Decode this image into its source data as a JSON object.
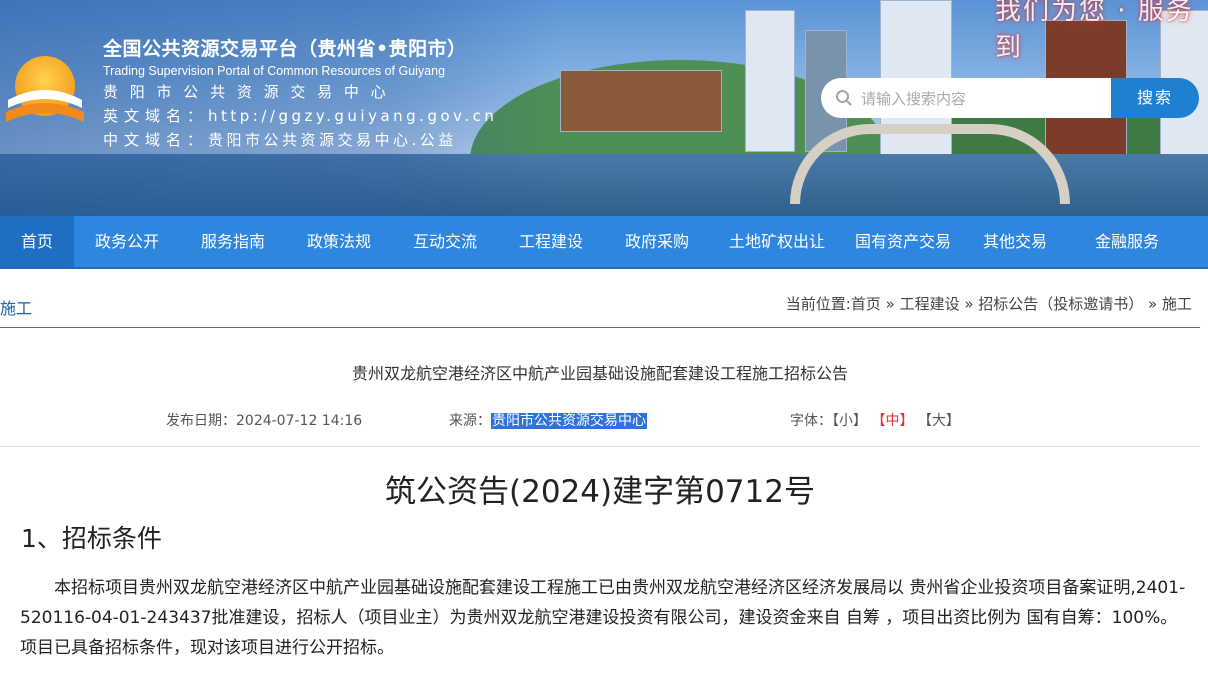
{
  "header": {
    "title_cn": "全国公共资源交易平台（贵州省•贵阳市）",
    "title_en": "Trading Supervision Portal of Common Resources of Guiyang",
    "center_name": "贵 阳 市 公 共 资 源 交 易 中 心",
    "en_domain_label": "英文域名：",
    "en_domain_value": "http://ggzy.guiyang.gov.cn",
    "cn_domain_label": "中文域名：",
    "cn_domain_value": "贵阳市公共资源交易中心.公益",
    "banner_slogan": "我们为您 · 服务到"
  },
  "search": {
    "placeholder": "请输入搜索内容",
    "button": "搜索"
  },
  "nav": {
    "items": [
      "首页",
      "政务公开",
      "服务指南",
      "政策法规",
      "互动交流",
      "工程建设",
      "政府采购",
      "土地矿权出让",
      "国有资产交易",
      "其他交易",
      "金融服务"
    ],
    "active": "首页"
  },
  "breadcrumb": {
    "category": "施工",
    "path": "当前位置:首页 » 工程建设 » 招标公告（投标邀请书） » 施工"
  },
  "article": {
    "title": "贵州双龙航空港经济区中航产业园基础设施配套建设工程施工招标公告",
    "date_label": "发布日期：",
    "date_value": "2024-07-12 14:16",
    "source_label": "来源：",
    "source_value": "贵阳市公共资源交易中心",
    "font_label": "字体：",
    "font_small": "【小】",
    "font_medium": "【中】",
    "font_large": "【大】",
    "doc_number": "筑公资告(2024)建字第0712号",
    "section_title": "1、招标条件",
    "paragraph": "本招标项目贵州双龙航空港经济区中航产业园基础设施配套建设工程施工已由贵州双龙航空港经济区经济发展局以 贵州省企业投资项目备案证明,2401-520116-04-01-243437批准建设，招标人（项目业主）为贵州双龙航空港建设投资有限公司，建设资金来自 自筹 ，项目出资比例为 国有自筹：100%。 项目已具备招标条件，现对该项目进行公开招标。"
  },
  "colors": {
    "nav_bg": "#2e86de",
    "nav_active": "#1e6fc2",
    "search_button": "#1f7fd1",
    "link_blue": "#1d5fa8",
    "highlight": "#2f73d9",
    "font_medium": "#dd3333"
  }
}
